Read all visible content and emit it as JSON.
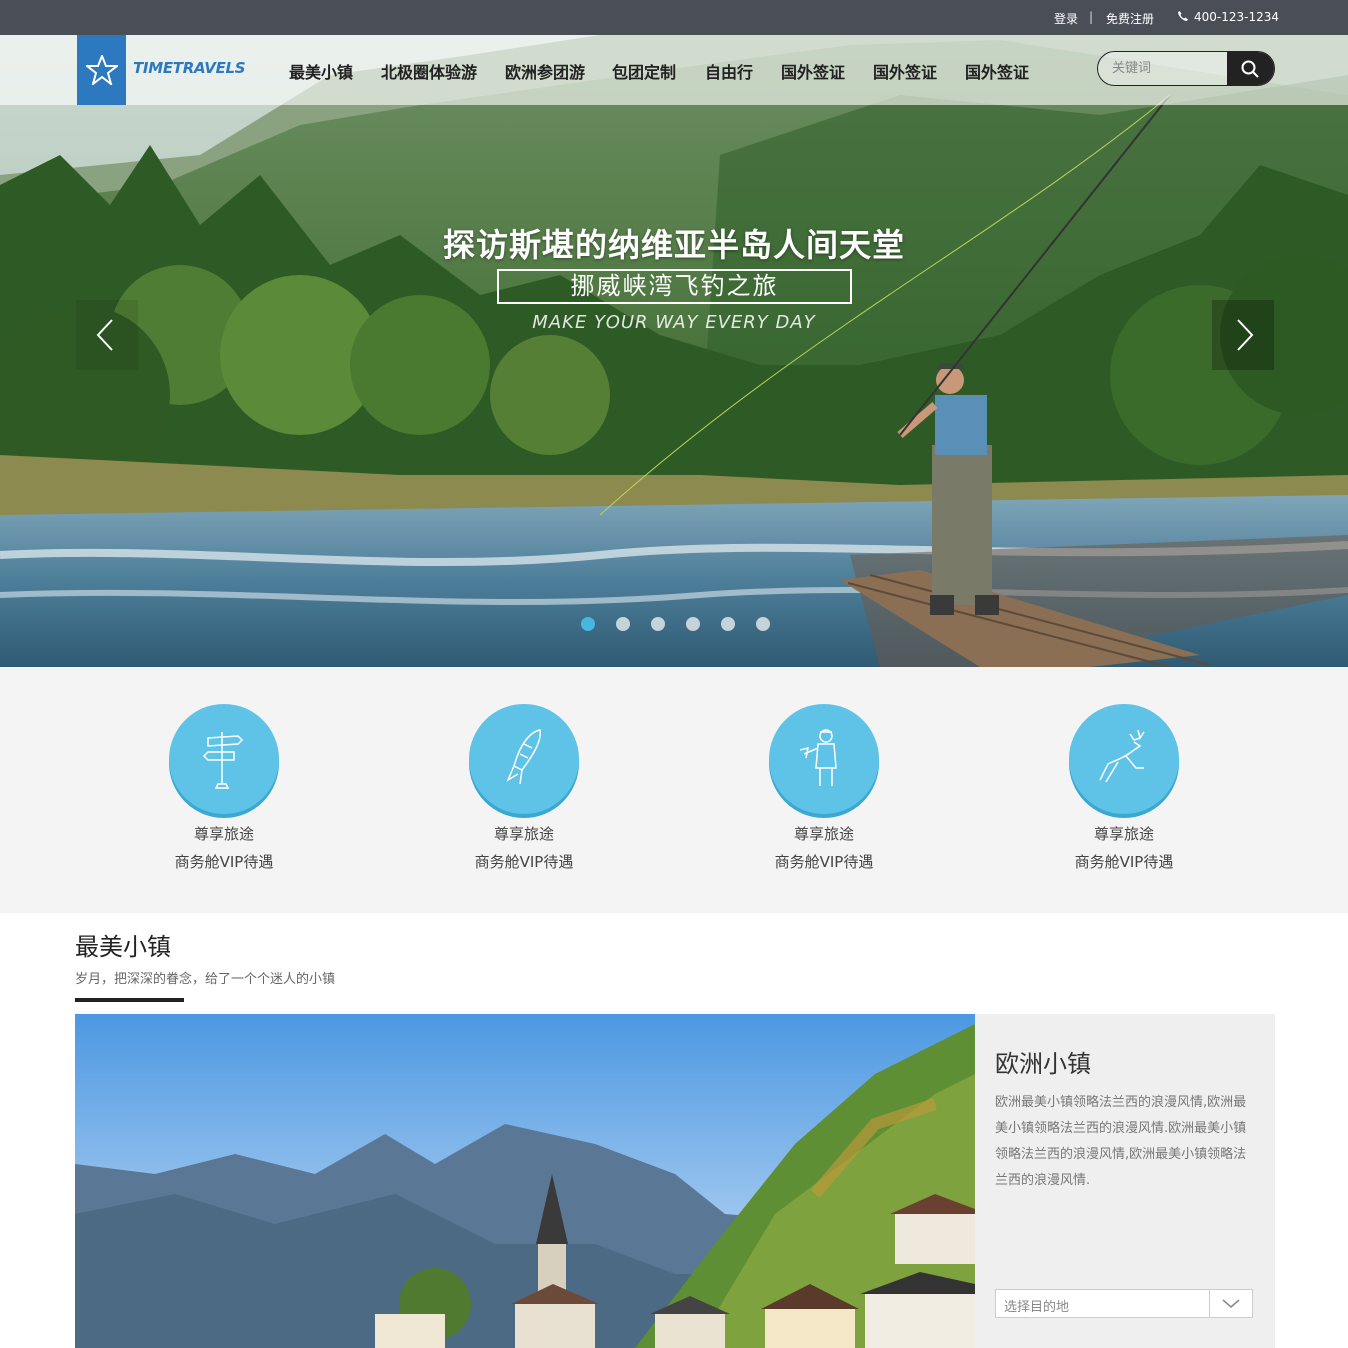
{
  "topbar": {
    "login": "登录",
    "separator": "|",
    "register": "免费注册",
    "phone": "400-123-1234"
  },
  "brand": {
    "name": "TIMETRAVELS",
    "color": "#2d79c0"
  },
  "nav": {
    "items": [
      "最美小镇",
      "北极圈体验游",
      "欧洲参团游",
      "包团定制",
      "自由行",
      "国外签证",
      "国外签证",
      "国外签证"
    ]
  },
  "search": {
    "placeholder": "关键词",
    "icon": "search-icon"
  },
  "hero": {
    "title": "探访斯堪的纳维亚半岛人间天堂",
    "subtitle": "挪威峡湾飞钓之旅",
    "tagline": "MAKE YOUR WAY EVERY DAY",
    "slides": 6,
    "active_slide": 1
  },
  "features": [
    {
      "icon": "signpost-icon",
      "line1": "尊享旅途",
      "line2": "商务舱VIP待遇"
    },
    {
      "icon": "rocket-icon",
      "line1": "尊享旅途",
      "line2": "商务舱VIP待遇"
    },
    {
      "icon": "lumberjack-icon",
      "line1": "尊享旅途",
      "line2": "商务舱VIP待遇"
    },
    {
      "icon": "deer-icon",
      "line1": "尊享旅途",
      "line2": "商务舱VIP待遇"
    }
  ],
  "section": {
    "title": "最美小镇",
    "subtitle": "岁月，把深深的眷念，给了一个个迷人的小镇"
  },
  "town": {
    "title": "欧洲小镇",
    "description": "欧洲最美小镇领略法兰西的浪漫风情,欧洲最美小镇领略法兰西的浪漫风情.欧洲最美小镇领略法兰西的浪漫风情,欧洲最美小镇领略法兰西的浪漫风情.",
    "select_placeholder": "选择目的地"
  },
  "colors": {
    "topbar": "#4a4f57",
    "accent": "#5ec3e6",
    "active_dot": "#48b7e0"
  }
}
